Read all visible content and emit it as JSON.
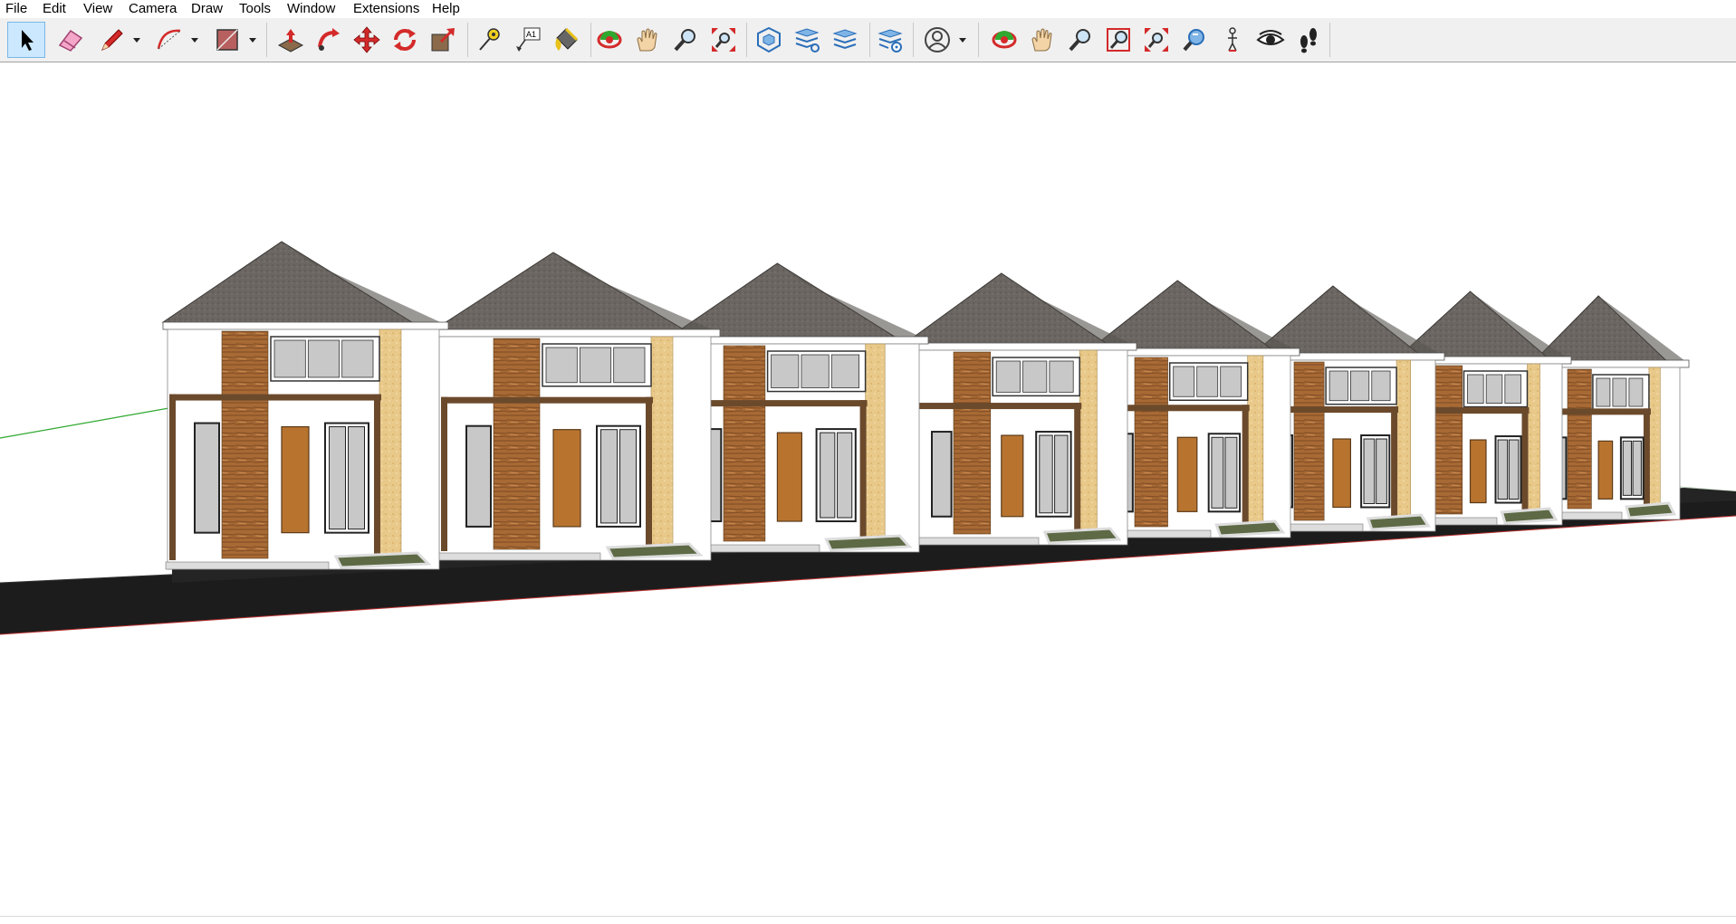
{
  "menu": {
    "file": "File",
    "edit": "Edit",
    "view": "View",
    "camera": "Camera",
    "draw": "Draw",
    "tools": "Tools",
    "window": "Window",
    "extensions": "Extensions",
    "help": "Help"
  },
  "toolbar": {
    "text_icon_label": "A1",
    "active_tool": "select-tool"
  },
  "viewport": {
    "model": "row houses",
    "house_count": 8,
    "axis_color": "#2fa82f",
    "road_color": "#1c1c1c",
    "roof_color": "#6b6662",
    "wood_color": "#a86a35",
    "wall_color": "#ffffff",
    "accent_wall_color": "#e8c98a",
    "frame_color": "#6b4a2c",
    "glass_color": "#c8c8c8"
  }
}
